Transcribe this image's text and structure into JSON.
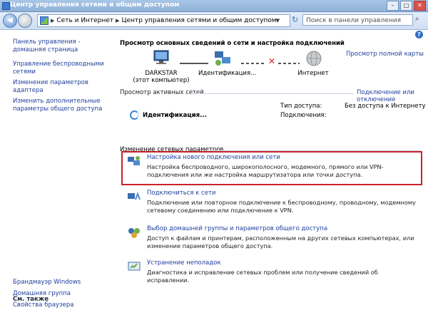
{
  "window": {
    "title": "Центр управления сетями и общим доступом"
  },
  "address": {
    "crumbs": [
      "Сеть и Интернет",
      "Центр управления сетями и общим доступом"
    ],
    "search_placeholder": "Поиск в панели управления"
  },
  "sidebar": {
    "items": [
      "Панель управления - домашняя страница",
      "Управление беспроводными сетями",
      "Изменение параметров адаптера",
      "Изменить дополнительные параметры общего доступа"
    ],
    "see_also_title": "См. также",
    "see_also": [
      "Брандмауэр Windows",
      "Домашняя группа",
      "Свойства браузера"
    ]
  },
  "main": {
    "title": "Просмотр основных сведений о сети и настройка подключений",
    "full_map": "Просмотр полной карты",
    "map": {
      "computer_name": "DARKSTAR",
      "computer_sub": "(этот компьютер)",
      "network_name": "Идентификация...",
      "internet_name": "Интернет"
    },
    "active_header": "Просмотр активных сетей",
    "connect_link": "Подключение или отключение",
    "active_network": "Идентификация...",
    "access_type_label": "Тип доступа:",
    "access_type_value": "Без доступа к Интернету",
    "connections_label": "Подключения:",
    "change_header": "Изменение сетевых параметров",
    "tasks": [
      {
        "title": "Настройка нового подключения или сети",
        "desc": "Настройка беспроводного, широкополосного, модемного, прямого или VPN-подключения или же настройка маршрутизатора или точки доступа."
      },
      {
        "title": "Подключиться к сети",
        "desc": "Подключение или повторное подключение к беспроводному, проводному, модемному сетевому соединению или подключение к VPN."
      },
      {
        "title": "Выбор домашней группы и параметров общего доступа",
        "desc": "Доступ к файлам и принтерам, расположенным на других сетевых компьютерах, или изменение параметров общего доступа."
      },
      {
        "title": "Устранение неполадок",
        "desc": "Диагностика и исправление сетевых проблем или получение сведений об исправлении."
      }
    ]
  },
  "colors": {
    "link": "#1f3e9c",
    "highlight": "#c8222a"
  },
  "icons": [
    "back-icon",
    "forward-icon",
    "control-panel-icon",
    "refresh-icon",
    "search-icon",
    "help-icon",
    "computer-icon",
    "network-icon",
    "globe-icon",
    "error-x-icon"
  ]
}
